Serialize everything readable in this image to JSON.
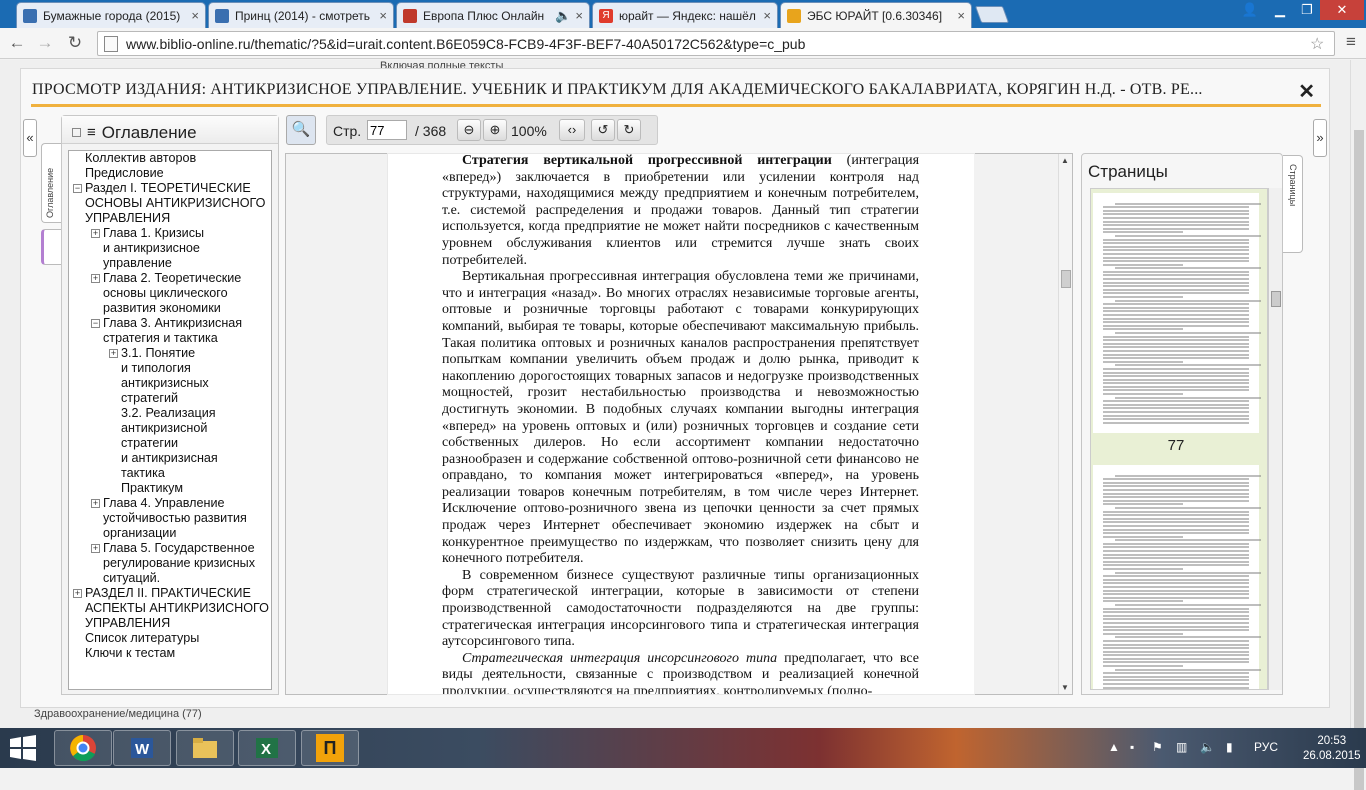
{
  "browser": {
    "tabs": [
      {
        "label": "Бумажные города (2015)",
        "fav_color": "#3a6fb0",
        "active": false
      },
      {
        "label": "Принц (2014) - смотреть",
        "fav_color": "#3a6fb0",
        "active": false
      },
      {
        "label": "Европа Плюс Онлайн",
        "fav_color": "#c0392b",
        "active": false
      },
      {
        "label": "юрайт — Яндекс: нашёл",
        "fav_color": "#e03b2c",
        "active": false
      },
      {
        "label": "ЭБС ЮРАЙТ [0.6.30346]",
        "fav_color": "#e8a41c",
        "active": true
      }
    ],
    "url": "www.biblio-online.ru/thematic/?5&id=urait.content.B6E059C8-FCB9-4F3F-BEF7-40A50172C562&type=c_pub",
    "back_icon": "back-arrow-icon",
    "forward_icon": "forward-arrow-icon",
    "reload_icon": "reload-icon"
  },
  "page": {
    "behind_text": "Включая полные тексты",
    "behind_bottom": "Здравоохранение/медицина (77)"
  },
  "viewer": {
    "title": "ПРОСМОТР ИЗДАНИЯ: АНТИКРИЗИСНОЕ УПРАВЛЕНИЕ. УЧЕБНИК И ПРАКТИКУМ ДЛЯ АКАДЕМИЧЕСКОГО БАКАЛАВРИАТА, КОРЯГИН Н.Д. - ОТВ. РЕ...",
    "close": "✕",
    "accent": "#f0b13e"
  },
  "toc": {
    "header": "Оглавление",
    "side_tab": "Оглавление",
    "items": [
      {
        "text": "Коллектив авторов",
        "level": 0,
        "exp": ""
      },
      {
        "text": "Предисловие",
        "level": 0,
        "exp": ""
      },
      {
        "text": "Раздел I. ТЕОРЕТИЧЕСКИЕ",
        "level": 0,
        "exp": "−"
      },
      {
        "text": "ОСНОВЫ АНТИКРИЗИСНОГО",
        "level": 0,
        "exp": ""
      },
      {
        "text": "УПРАВЛЕНИЯ",
        "level": 0,
        "exp": ""
      },
      {
        "text": "Глава 1. Кризисы",
        "level": 1,
        "exp": "+"
      },
      {
        "text": "и антикризисное",
        "level": 1,
        "exp": ""
      },
      {
        "text": "управление",
        "level": 1,
        "exp": ""
      },
      {
        "text": "Глава 2. Теоретические",
        "level": 1,
        "exp": "+"
      },
      {
        "text": "основы циклического",
        "level": 1,
        "exp": ""
      },
      {
        "text": "развития экономики",
        "level": 1,
        "exp": ""
      },
      {
        "text": "Глава 3. Антикризисная",
        "level": 1,
        "exp": "−"
      },
      {
        "text": "стратегия и тактика",
        "level": 1,
        "exp": ""
      },
      {
        "text": "3.1. Понятие",
        "level": 2,
        "exp": "+"
      },
      {
        "text": "и типология",
        "level": 2,
        "exp": ""
      },
      {
        "text": "антикризисных",
        "level": 2,
        "exp": ""
      },
      {
        "text": "стратегий",
        "level": 2,
        "exp": ""
      },
      {
        "text": "3.2. Реализация",
        "level": 2,
        "exp": ""
      },
      {
        "text": "антикризисной",
        "level": 2,
        "exp": ""
      },
      {
        "text": "стратегии",
        "level": 2,
        "exp": ""
      },
      {
        "text": "и антикризисная",
        "level": 2,
        "exp": ""
      },
      {
        "text": "тактика",
        "level": 2,
        "exp": ""
      },
      {
        "text": "Практикум",
        "level": 2,
        "exp": ""
      },
      {
        "text": "Глава 4. Управление",
        "level": 1,
        "exp": "+"
      },
      {
        "text": "устойчивостью развития",
        "level": 1,
        "exp": ""
      },
      {
        "text": "организации",
        "level": 1,
        "exp": ""
      },
      {
        "text": "Глава 5. Государственное",
        "level": 1,
        "exp": "+"
      },
      {
        "text": "регулирование кризисных",
        "level": 1,
        "exp": ""
      },
      {
        "text": "ситуаций.",
        "level": 1,
        "exp": ""
      },
      {
        "text": "РАЗДЕЛ II. ПРАКТИЧЕСКИЕ",
        "level": 0,
        "exp": "+"
      },
      {
        "text": "АСПЕКТЫ АНТИКРИЗИСНОГО",
        "level": 0,
        "exp": ""
      },
      {
        "text": "УПРАВЛЕНИЯ",
        "level": 0,
        "exp": ""
      },
      {
        "text": "Список литературы",
        "level": 0,
        "exp": ""
      },
      {
        "text": "Ключи к тестам",
        "level": 0,
        "exp": ""
      }
    ]
  },
  "reader": {
    "page_label": "Стр.",
    "page_value": "77",
    "page_sep": "/ 368",
    "zoom": "100%",
    "search_icon": "magnifier-icon"
  },
  "document": {
    "paragraphs": [
      "(интеграция «вперед») заключается в приобретении или усилении контроля над структурами, находящимися между предприятием и конечным потребителем, т.е. системой распределения и продажи товаров. Данный тип стратегии используется, когда предприятие не может найти посредников с качественным уровнем обслуживания клиентов или стремится лучше знать своих потребителей.",
      "Вертикальная прогрессивная интеграция обусловлена теми же причинами, что и интеграция «назад». Во многих отраслях независимые торговые агенты, оптовые и розничные торговцы работают с товарами конкурирующих компаний, выбирая те товары, которые обеспечивают максимальную прибыль. Такая политика оптовых и розничных каналов распространения препятствует попыткам компании увеличить объем продаж и долю рынка, приводит к накоплению дорогостоящих товарных запасов и недогрузке производственных мощностей, грозит нестабильностью производства и невозможностью достигнуть экономии. В подобных случаях компании выгодны интеграция «вперед» на уровень оптовых и (или) розничных торговцев и создание сети собственных дилеров. Но если ассортимент компании недостаточно разнообразен и содержание собственной оптово-розничной сети финансово не оправдано, то компания может интегрироваться «вперед», на уровень реализации товаров конечным потребителям, в том числе через Интернет. Исключение оптово-розничного звена из цепочки ценности за счет прямых продаж через Интернет обеспечивает экономию издержек на сбыт и конкурентное преимущество по издержкам, что позволяет снизить цену для конечного потребителя.",
      "В современном бизнесе существуют различные типы организационных форм стратегической интеграции, которые в зависимости от степени производственной самодостаточности подразделяются на две группы: стратегическая интеграция инсорсингового типа и стратегическая интеграция аутсорсингового типа.",
      "предполагает, что все виды деятельности, связанные с производством и реализацией конечной продукции, осуществляются на предприятиях, контролируемых (полно-"
    ],
    "lead_bold": "Стратегия вертикальной прогрессивной интеграции",
    "lead_italic": "Стратегическая интеграция инсорсингового типа"
  },
  "pages_panel": {
    "header": "Страницы",
    "side_tab": "Страницы",
    "current_number": "77"
  },
  "taskbar": {
    "apps": [
      "chrome-icon",
      "word-icon",
      "explorer-icon",
      "excel-icon",
      "app-p-icon"
    ],
    "app_p_letter": "П",
    "lang": "РУС",
    "time": "20:53",
    "date": "26.08.2015"
  }
}
